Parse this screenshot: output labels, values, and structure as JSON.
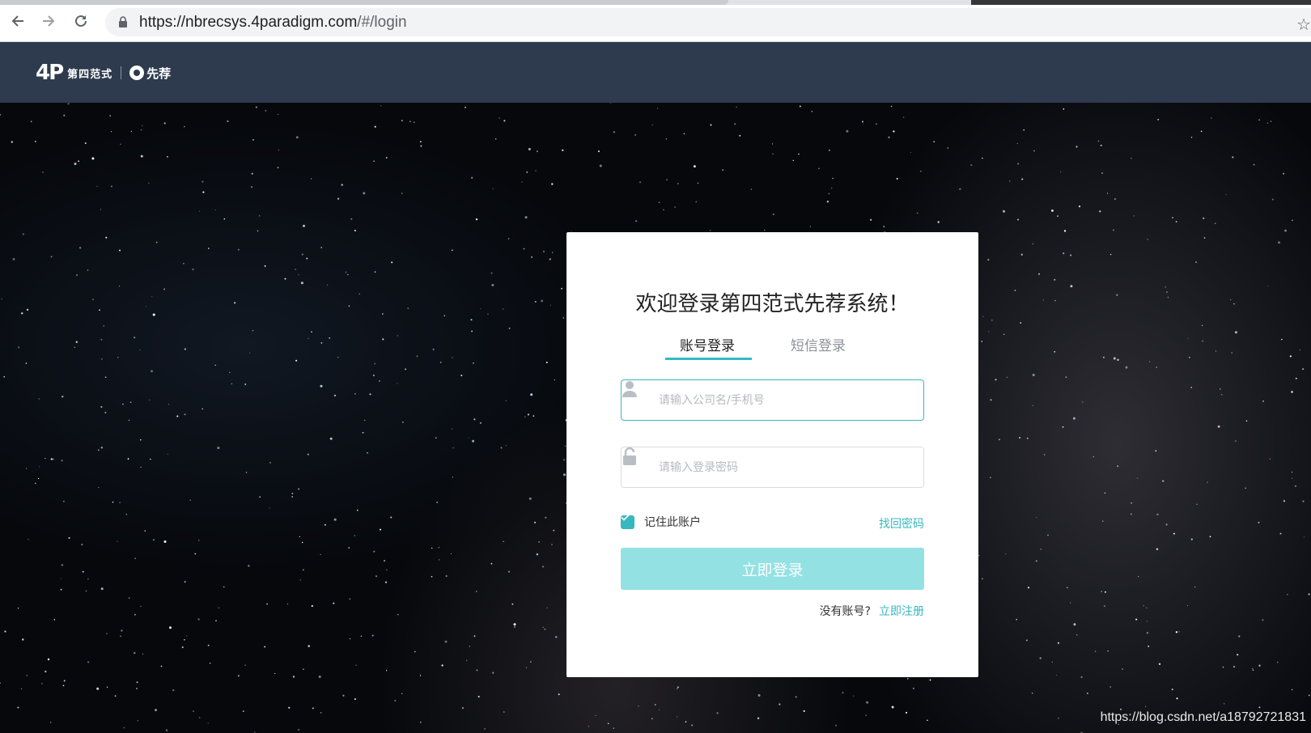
{
  "browser": {
    "url_host": "https://nbrecsys.4paradigm.com",
    "url_path": "/#/login"
  },
  "header": {
    "logo_mark": "4P",
    "logo_company": "第四范式",
    "logo_product": "先荐"
  },
  "login": {
    "title": "欢迎登录第四范式先荐系统！",
    "tabs": [
      {
        "label": "账号登录",
        "active": true
      },
      {
        "label": "短信登录",
        "active": false
      }
    ],
    "username_placeholder": "请输入公司名/手机号",
    "password_placeholder": "请输入登录密码",
    "remember_label": "记住此账户",
    "remember_checked": true,
    "forgot_label": "找回密码",
    "submit_label": "立即登录",
    "no_account_text": "没有账号?",
    "register_label": "立即注册"
  },
  "watermark": "https://blog.csdn.net/a18792721831",
  "colors": {
    "accent": "#36b8c0",
    "button_bg": "#93e1e3",
    "header_bg": "#2e3b4e"
  }
}
